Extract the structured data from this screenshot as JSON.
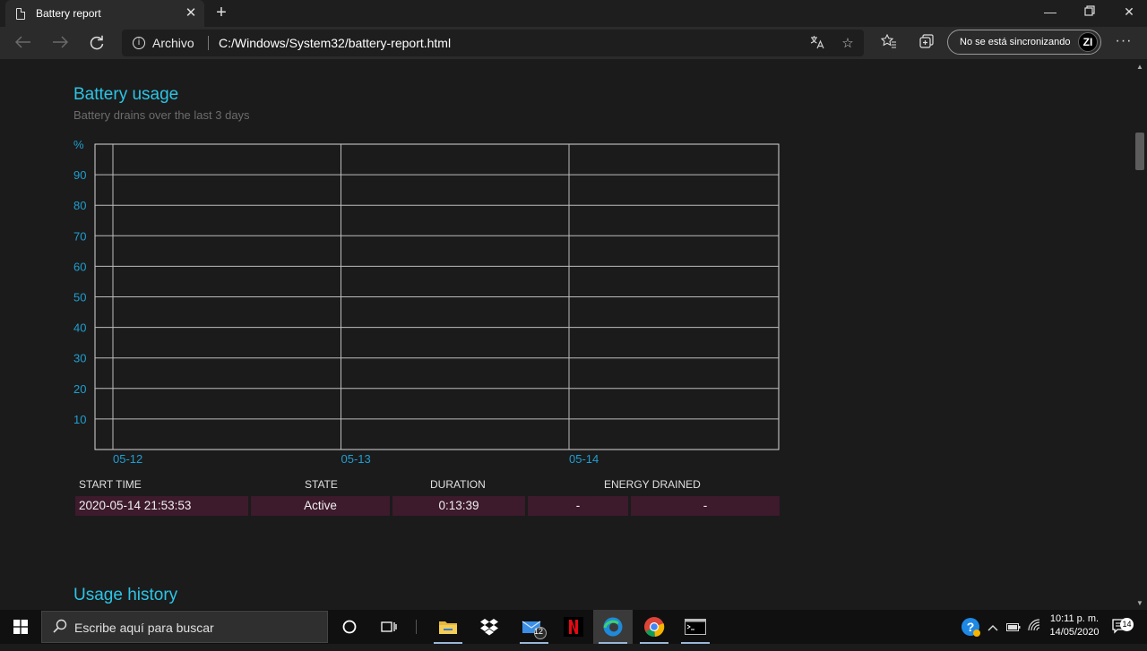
{
  "window": {
    "tab_title": "Battery report",
    "new_tab_icon": "+",
    "minimize_icon": "—",
    "restore_icon": "❐",
    "close_icon": "✕"
  },
  "toolbar": {
    "address_protocol_label": "Archivo",
    "url": "C:/Windows/System32/battery-report.html",
    "sync_label": "No se está sincronizando",
    "avatar_initials": "ZI"
  },
  "report": {
    "usage_title": "Battery usage",
    "usage_subtitle": "Battery drains over the last 3 days",
    "history_title": "Usage history",
    "table": {
      "headers": [
        "START TIME",
        "STATE",
        "DURATION",
        "ENERGY DRAINED"
      ],
      "rows": [
        {
          "start_time": "2020-05-14  21:53:53",
          "state": "Active",
          "duration": "0:13:39",
          "energy_pct": "-",
          "energy_mwh": "-"
        }
      ]
    }
  },
  "chart_data": {
    "type": "line",
    "ylabel": "%",
    "ylim": [
      0,
      100
    ],
    "y_ticks": [
      "10",
      "20",
      "30",
      "40",
      "50",
      "60",
      "70",
      "80",
      "90"
    ],
    "x_ticks": [
      "05-12",
      "05-13",
      "05-14"
    ],
    "series": [],
    "grid": true,
    "colors": {
      "axis_text": "#1f9fd1",
      "grid": "#bdbdbd",
      "plot_border": "#d8d8d8"
    }
  },
  "taskbar": {
    "search_placeholder": "Escribe aquí para buscar",
    "mail_badge": "12",
    "clock_time": "10:11 p. m.",
    "clock_date": "14/05/2020",
    "notification_count": "14"
  }
}
